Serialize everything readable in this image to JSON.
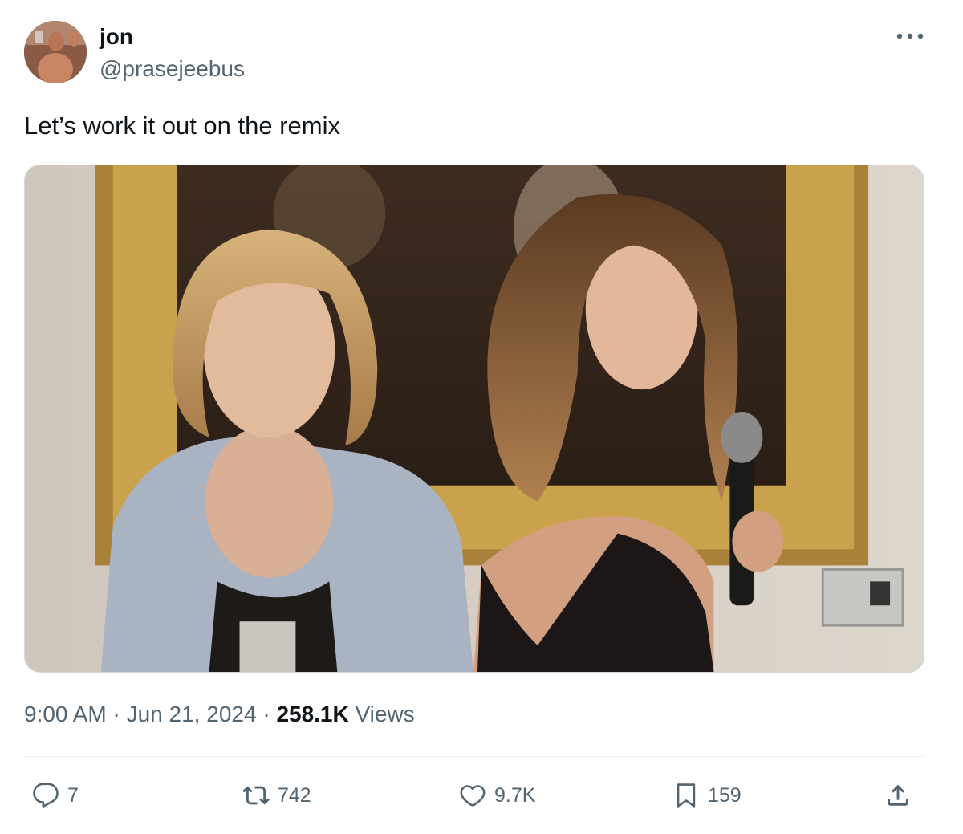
{
  "author": {
    "display_name": "jon",
    "handle": "@prasejeebus",
    "avatar_icon": "user-avatar"
  },
  "tweet": {
    "text": "Let’s work it out on the remix",
    "time": "9:00 AM",
    "separator": " · ",
    "date": "Jun 21, 2024",
    "views_count": "258.1K",
    "views_label": " Views"
  },
  "actions": {
    "reply_count": "7",
    "repost_count": "742",
    "like_count": "9.7K",
    "bookmark_count": "159"
  },
  "colors": {
    "text_primary": "#0f1419",
    "text_secondary": "#536471",
    "divider": "#eff3f4"
  }
}
